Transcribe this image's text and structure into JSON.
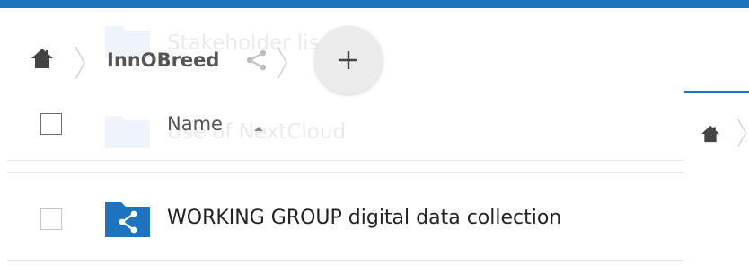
{
  "breadcrumb": {
    "home_icon": "home-icon",
    "current": "InnOBreed",
    "share_icon": "share-icon"
  },
  "add_button": {
    "icon": "plus-icon"
  },
  "file_list": {
    "name_header": "Name",
    "sort_direction": "ascending",
    "rows": [
      {
        "name": "WORKING GROUP digital data collection",
        "type": "shared-folder"
      }
    ]
  },
  "background_rows": [
    {
      "name": "Stakeholder lis"
    },
    {
      "name": "Use of NextCloud"
    }
  ],
  "colors": {
    "accent": "#1e73be",
    "folder": "#1e73be",
    "text": "#222222",
    "muted": "#555555"
  }
}
